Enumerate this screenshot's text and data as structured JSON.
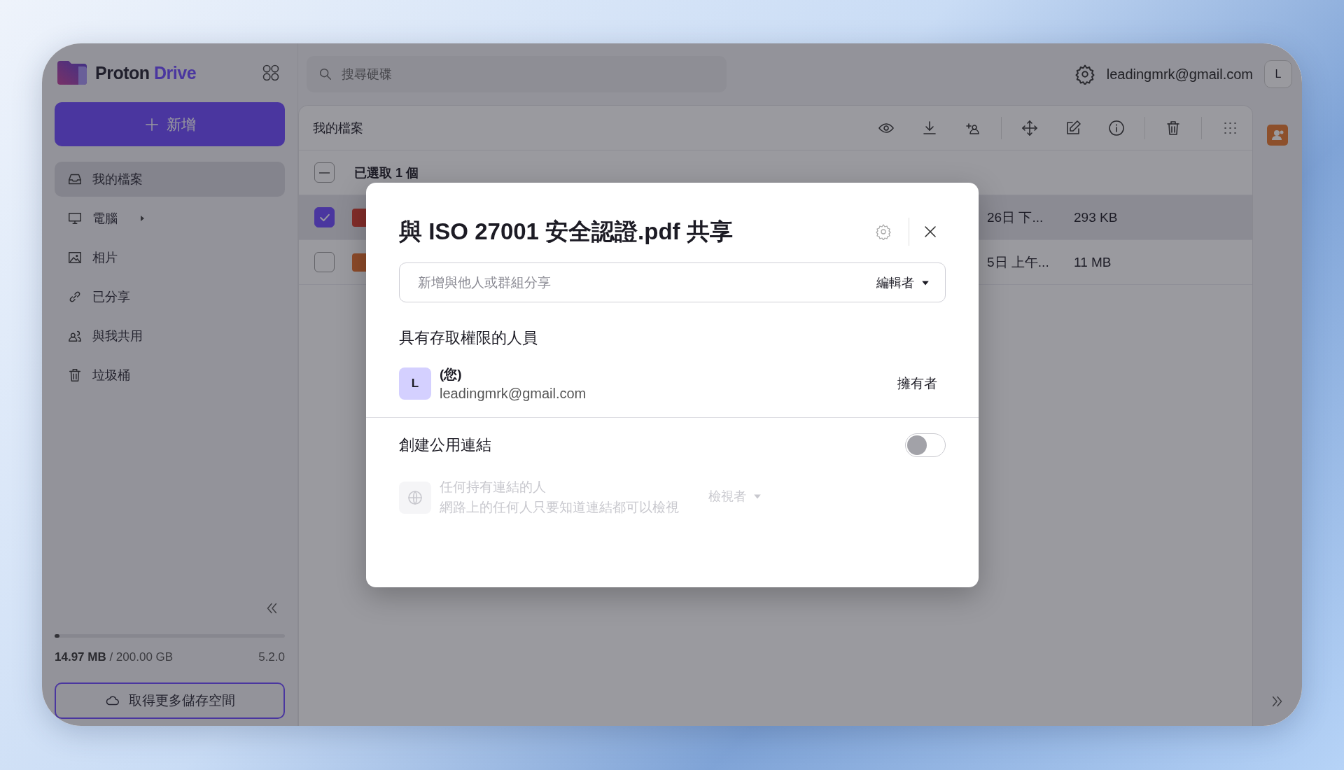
{
  "app": {
    "logo": {
      "brand": "Proton",
      "product": "Drive"
    }
  },
  "sidebar": {
    "new_button": "新增",
    "items": [
      {
        "label": "我的檔案",
        "selected": true,
        "expandable": false
      },
      {
        "label": "電腦",
        "selected": false,
        "expandable": true
      },
      {
        "label": "相片",
        "selected": false,
        "expandable": false
      },
      {
        "label": "已分享",
        "selected": false,
        "expandable": false
      },
      {
        "label": "與我共用",
        "selected": false,
        "expandable": false
      },
      {
        "label": "垃圾桶",
        "selected": false,
        "expandable": false
      }
    ],
    "storage": {
      "level": 0.02,
      "usage": "**14.97 MB** / 200.00 GB",
      "version": "5.2.0"
    },
    "upgrade_button": "取得更多儲存空間"
  },
  "topbar": {
    "search": {
      "placeholder": "搜尋硬碟"
    },
    "account": {
      "email": "leadingmrk@gmail.com",
      "avatar": "L"
    }
  },
  "file_list": {
    "title": "我的檔案",
    "selection": {
      "label": "已選取 1 個",
      "partial": true
    },
    "rows": [
      {
        "checked": true,
        "selected": true,
        "kind": "pdf",
        "date": "26日 下...",
        "size": "293 KB"
      },
      {
        "checked": false,
        "selected": false,
        "kind": "image",
        "date": "5日 上午...",
        "size": "11 MB"
      }
    ]
  },
  "modal": {
    "title": "與 ISO 27001 安全認證.pdf 共享",
    "invite": {
      "placeholder": "新增與他人或群組分享",
      "role": "編輯者"
    },
    "members_heading": "具有存取權限的人員",
    "members": [
      {
        "avatar": "L",
        "name": "(您)",
        "email": "leadingmrk@gmail.com",
        "role": "擁有者"
      }
    ],
    "public_link": {
      "label": "創建公用連結",
      "on": false,
      "title": "任何持有連結的人",
      "description": "網路上的任何人只要知道連結都可以檢視",
      "role": "檢視者"
    }
  }
}
